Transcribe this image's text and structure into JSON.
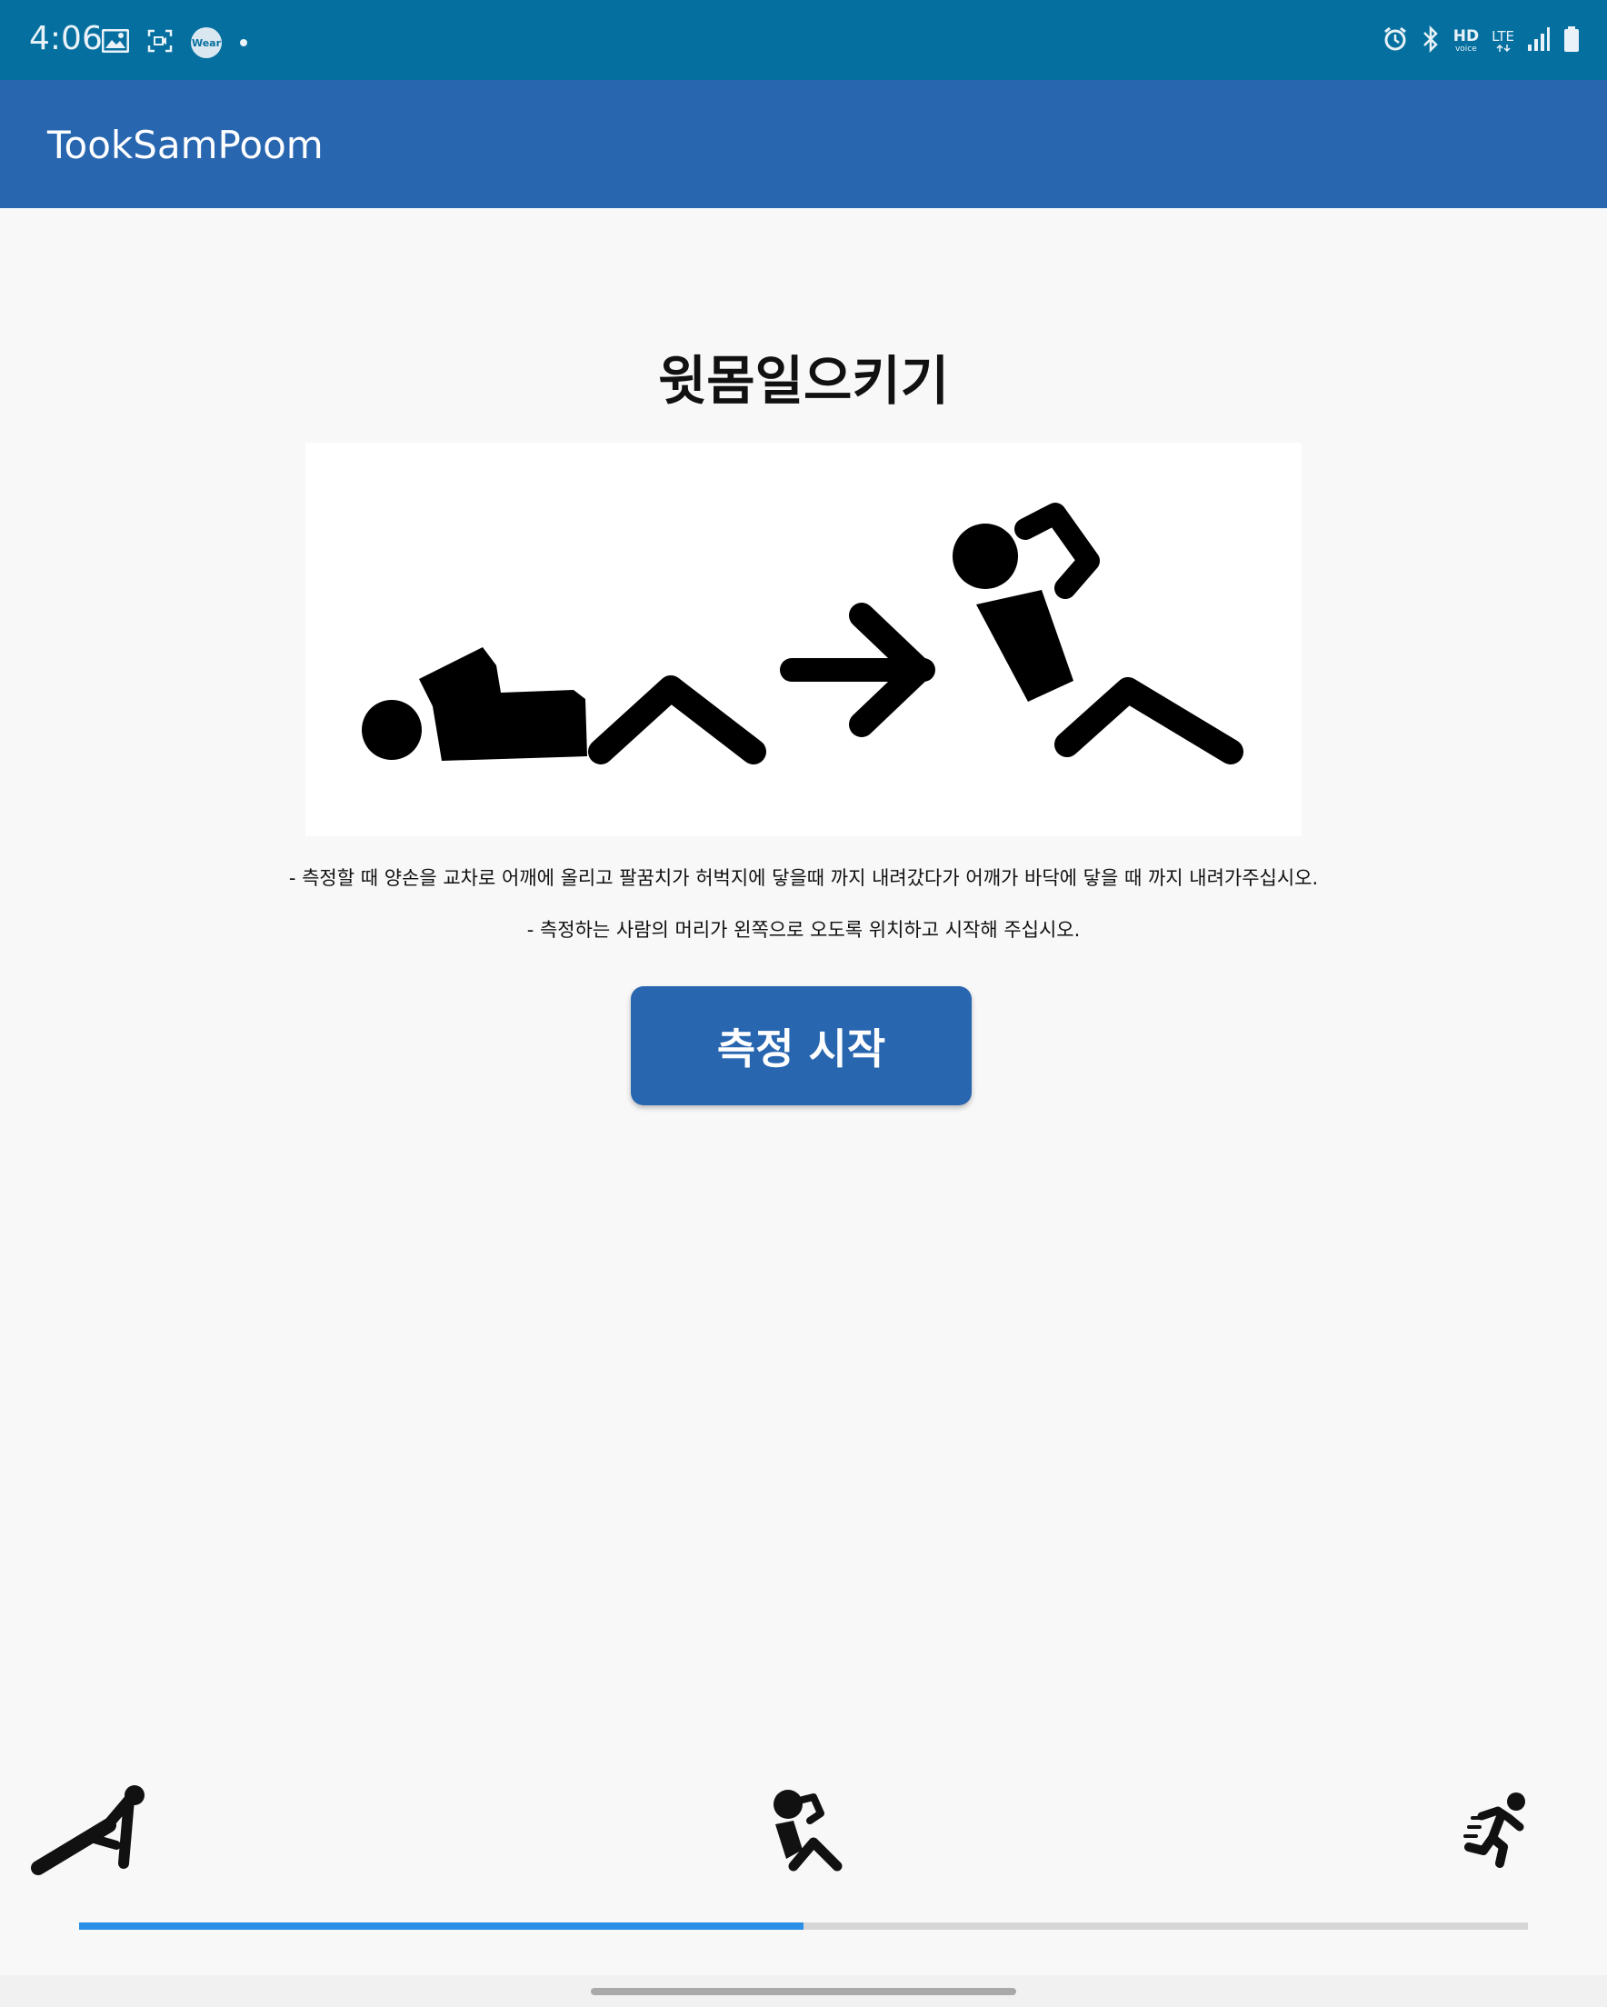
{
  "status_bar": {
    "time": "4:06",
    "left_icons": [
      "gallery-icon",
      "screen-record-icon",
      "wear-icon",
      "notification-dot"
    ],
    "wear_badge": "Wear",
    "right_icons": [
      "alarm-icon",
      "bluetooth-icon",
      "hd-voice-icon",
      "lte-icon",
      "signal-icon",
      "battery-icon"
    ],
    "hd": "HD",
    "voice": "voice",
    "lte": "LTE"
  },
  "app_bar": {
    "title": "TookSamPoom"
  },
  "main": {
    "heading": "윗몸일으키기",
    "illustration": "situp-illustration",
    "instructions": [
      "- 측정할 때 양손을 교차로 어깨에 올리고 팔꿈치가 허벅지에 닿을때 까지 내려갔다가 어깨가 바닥에 닿을 때 까지 내려가주십시오.",
      "- 측정하는 사람의 머리가 왼쪽으로 오도록 위치하고 시작해 주십시오."
    ],
    "start_button": "측정 시작"
  },
  "bottom_tabs": [
    {
      "icon": "pushup-icon",
      "selected": false
    },
    {
      "icon": "situp-icon",
      "selected": true
    },
    {
      "icon": "running-icon",
      "selected": false
    }
  ],
  "progress": {
    "value": 0.5
  },
  "colors": {
    "status_bar": "#05709f",
    "app_bar": "#2866b0",
    "button": "#2866b0",
    "progress_fill": "#2b8fe5",
    "progress_track": "#d6d6d6"
  }
}
